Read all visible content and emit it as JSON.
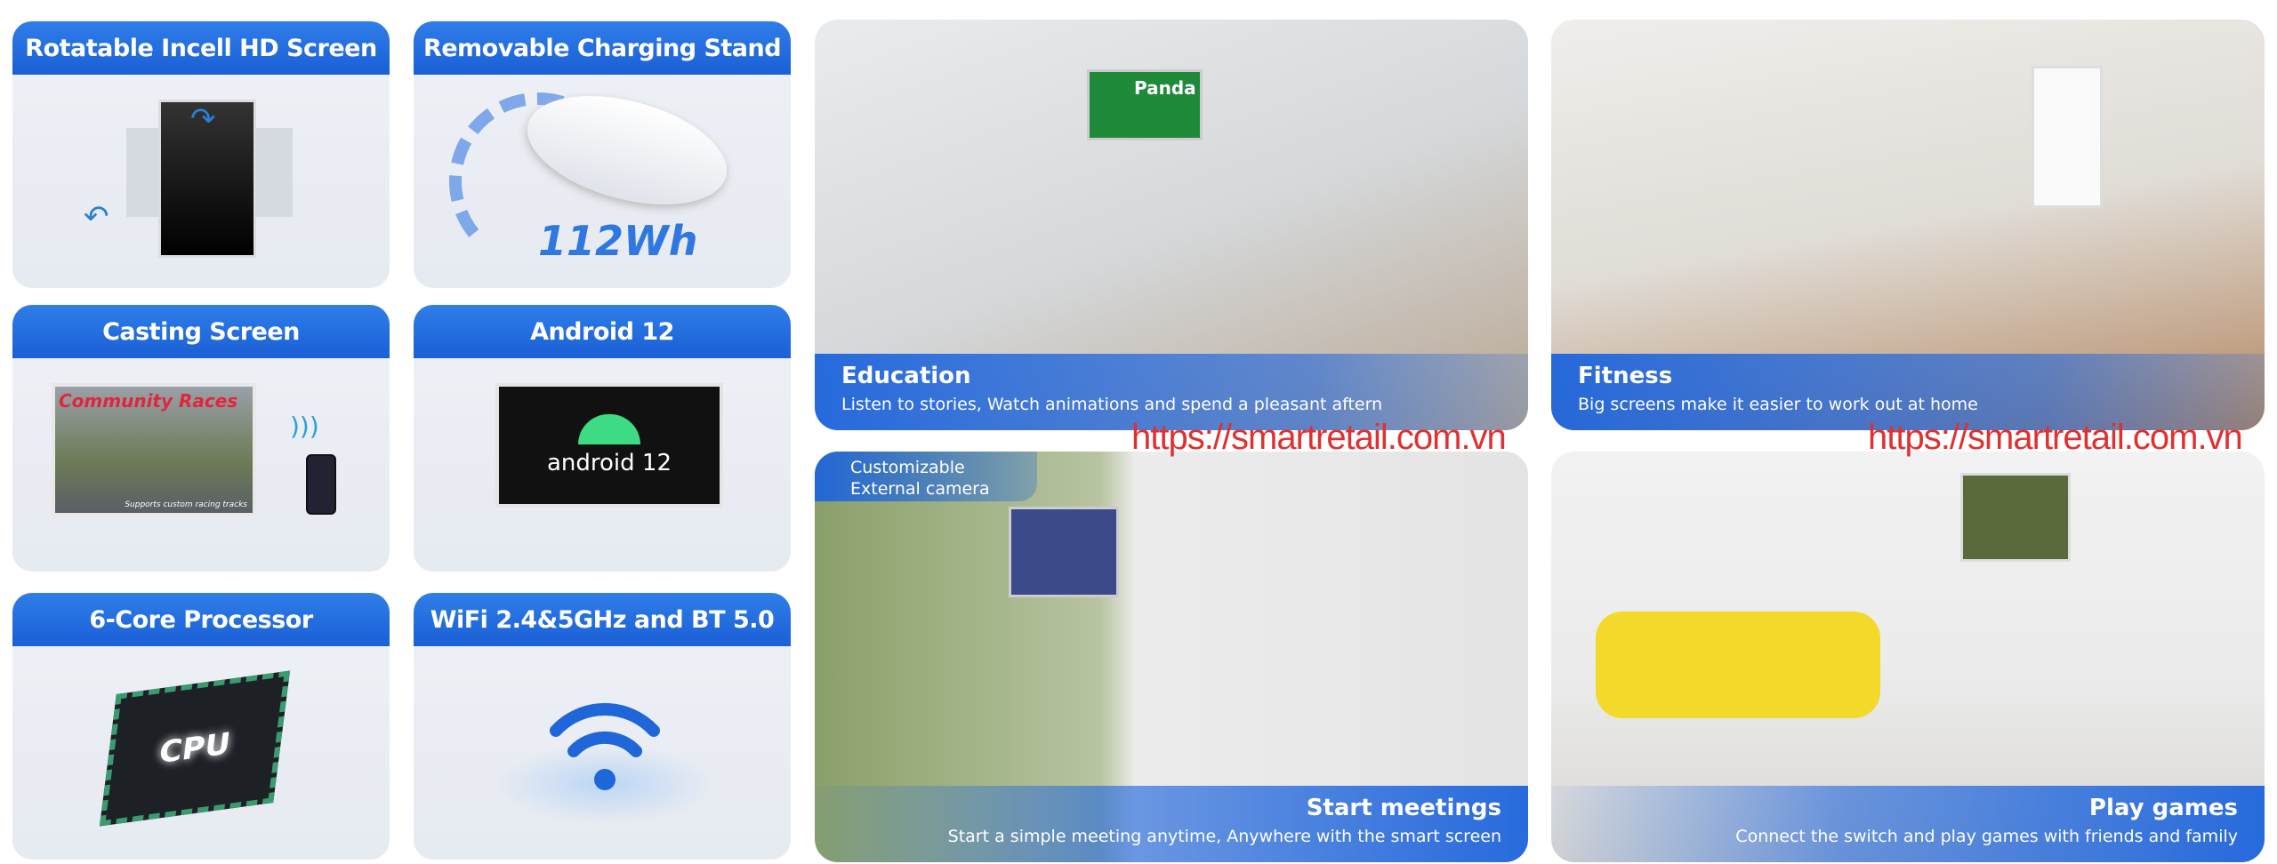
{
  "features": [
    {
      "title": "Rotatable Incell HD Screen",
      "icon": "rotate-screen-icon"
    },
    {
      "title": "Removable Charging Stand",
      "icon": "battery-stand-icon",
      "value": "112Wh"
    },
    {
      "title": "Casting Screen",
      "icon": "cast-icon",
      "screen_title": "Community Races",
      "screen_caption": "Supports custom racing tracks"
    },
    {
      "title": "Android 12",
      "icon": "android-icon",
      "screen_label": "android 12"
    },
    {
      "title": "6-Core Processor",
      "icon": "cpu-icon",
      "chip_label": "CPU"
    },
    {
      "title": "WiFi 2.4&5GHz and BT 5.0",
      "icon": "wifi-icon"
    }
  ],
  "scenes": [
    {
      "title": "Education",
      "subtitle": "Listen to stories, Watch animations and spend a pleasant aftern",
      "screen_label": "Panda"
    },
    {
      "title": "Fitness",
      "subtitle": "Big screens make it easier to work out at home"
    },
    {
      "title": "Start meetings",
      "subtitle": "Start a simple meeting anytime, Anywhere with the smart screen",
      "badge": "Customizable External camera"
    },
    {
      "title": "Play games",
      "subtitle": "Connect the switch and play games with friends and family"
    }
  ],
  "watermark": "https://smartretail.com.vn",
  "colors": {
    "accent": "#1f6fe0",
    "watermark": "#e03030"
  }
}
